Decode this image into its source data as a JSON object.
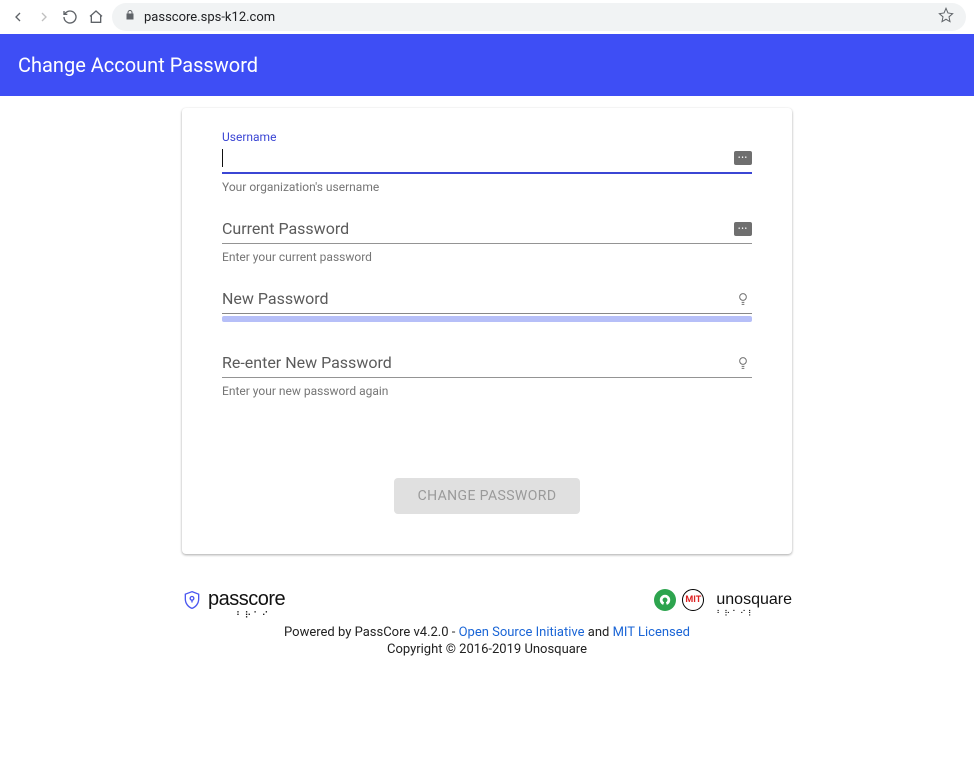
{
  "chrome": {
    "url": "passcore.sps-k12.com"
  },
  "header": {
    "title": "Change Account Password"
  },
  "form": {
    "username": {
      "label": "Username",
      "value": "",
      "helper": "Your organization's username"
    },
    "current": {
      "label": "Current Password",
      "helper": "Enter your current password"
    },
    "newpw": {
      "label": "New Password"
    },
    "confirm": {
      "label": "Re-enter New Password",
      "helper": "Enter your new password again"
    },
    "submit": "Change Password"
  },
  "footer": {
    "brand": "passcore",
    "partner": "unosquare",
    "mit_label": "MIT",
    "line1_prefix": "Powered by PassCore v4.2.0 - ",
    "line1_link1": "Open Source Initiative",
    "line1_mid": " and ",
    "line1_link2": "MIT Licensed",
    "line2": "Copyright © 2016-2019 Unosquare"
  }
}
